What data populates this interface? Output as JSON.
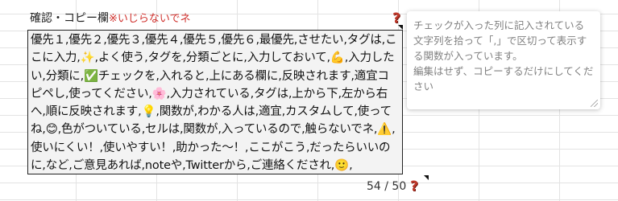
{
  "header": {
    "title": "確認・コピー欄",
    "note": "※いじらないでネ"
  },
  "cell": {
    "text": "優先１,優先２,優先３,優先４,優先５,優先６,最優先,させたい,タグは,ここに入力,✨,よく使う,タグを,分類ごとに,入力しておいて,💪,入力したい,分類に,✅チェックを,入れると,上にある欄に,反映されます,適宜コピペし,使ってください,🌸,入力されている,タグは,上から下,左から右へ,順に反映されます,💡,関数が,わかる人は,適宜,カスタムして,使ってね,😊,色がついている,セルは,関数が,入っているので,触らないでネ,⚠️,使いにくい！,使いやすい！,助かった～！,ここがこう,だったらいいのに,など,ご意見あれば,noteや,Twitterから,ご連絡くだされ,🙂,",
    "counter": "54 / 50"
  },
  "note": {
    "text": "チェックが入った列に記入されている文字列を拾って「,」で区切って表示する関数が入っています。\n編集はせず、コピーするだけにしてください"
  },
  "icons": {
    "help": "?",
    "help_color": "#c0392b"
  }
}
